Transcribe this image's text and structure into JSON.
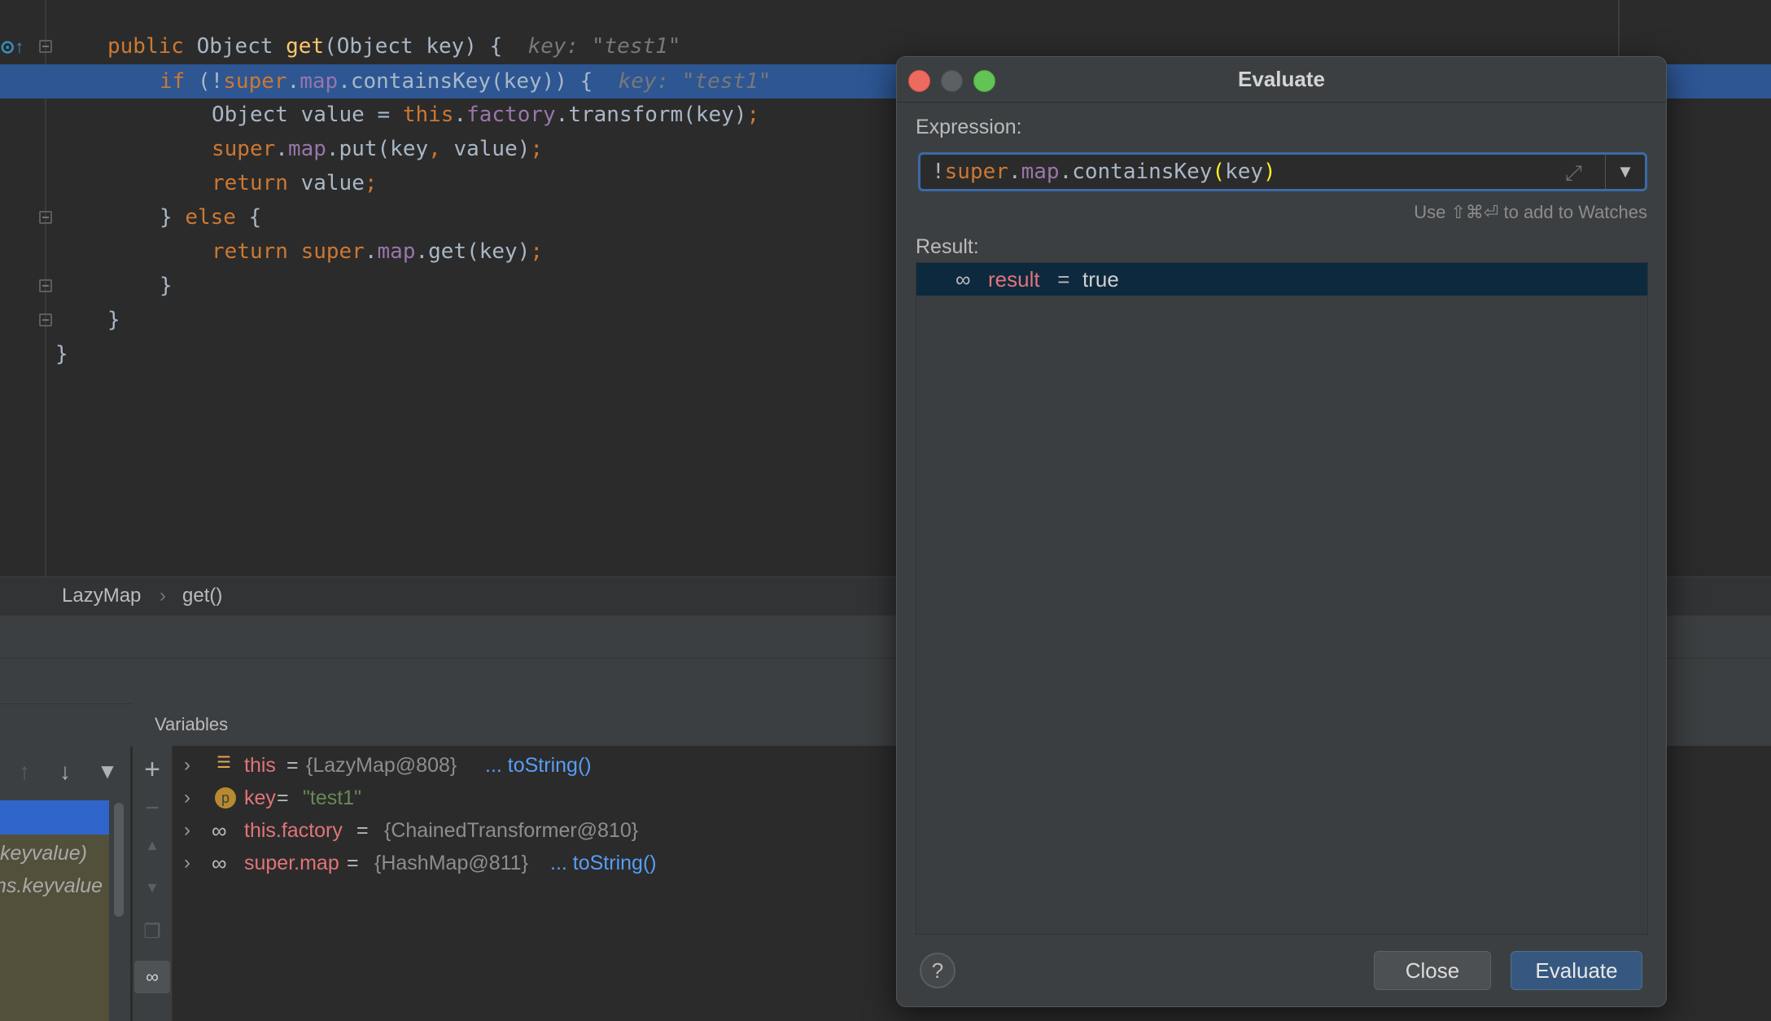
{
  "editor": {
    "lines": [
      {
        "tokens": [
          {
            "t": "public ",
            "c": "kw"
          },
          {
            "t": "Object ",
            "c": "plain"
          },
          {
            "t": "get",
            "c": "fn"
          },
          {
            "t": "(Object key) {",
            "c": "plain"
          },
          {
            "t": "  key: \"test1\"",
            "c": "hint"
          }
        ]
      },
      {
        "tokens": [
          {
            "t": "if ",
            "c": "kw"
          },
          {
            "t": "(!",
            "c": "plain"
          },
          {
            "t": "super",
            "c": "kw"
          },
          {
            "t": ".",
            "c": "plain"
          },
          {
            "t": "map",
            "c": "fld"
          },
          {
            "t": ".containsKey(key)) {",
            "c": "plain"
          },
          {
            "t": "  key: \"test1\"",
            "c": "hint"
          }
        ]
      },
      {
        "tokens": [
          {
            "t": "Object value = ",
            "c": "plain"
          },
          {
            "t": "this",
            "c": "kw"
          },
          {
            "t": ".",
            "c": "plain"
          },
          {
            "t": "factory",
            "c": "fld"
          },
          {
            "t": ".transform(key)",
            "c": "plain"
          },
          {
            "t": ";",
            "c": "kw"
          }
        ]
      },
      {
        "tokens": [
          {
            "t": "super",
            "c": "kw"
          },
          {
            "t": ".",
            "c": "plain"
          },
          {
            "t": "map",
            "c": "fld"
          },
          {
            "t": ".put(key",
            "c": "plain"
          },
          {
            "t": ", ",
            "c": "kw"
          },
          {
            "t": "value)",
            "c": "plain"
          },
          {
            "t": ";",
            "c": "kw"
          }
        ]
      },
      {
        "tokens": [
          {
            "t": "return ",
            "c": "kw"
          },
          {
            "t": "value",
            "c": "plain"
          },
          {
            "t": ";",
            "c": "kw"
          }
        ]
      },
      {
        "tokens": [
          {
            "t": "} ",
            "c": "plain"
          },
          {
            "t": "else ",
            "c": "kw"
          },
          {
            "t": "{",
            "c": "plain"
          }
        ]
      },
      {
        "tokens": [
          {
            "t": "return ",
            "c": "kw"
          },
          {
            "t": "super",
            "c": "kw"
          },
          {
            "t": ".",
            "c": "plain"
          },
          {
            "t": "map",
            "c": "fld"
          },
          {
            "t": ".get(key)",
            "c": "plain"
          },
          {
            "t": ";",
            "c": "kw"
          }
        ]
      },
      {
        "tokens": [
          {
            "t": "}",
            "c": "plain"
          }
        ]
      },
      {
        "tokens": [
          {
            "t": "}",
            "c": "plain"
          }
        ]
      },
      {
        "tokens": [
          {
            "t": "}",
            "c": "plain"
          }
        ]
      }
    ]
  },
  "breadcrumb": {
    "class_name": "LazyMap",
    "separator": "›",
    "method": "get()"
  },
  "debugger": {
    "variables_title": "Variables",
    "frames": [
      "keyvalue)",
      "ns.keyvalue"
    ],
    "variables": [
      {
        "name": "this",
        "eq": " = ",
        "value": "{LazyMap@808}",
        "link": "... toString()",
        "icon": "field-list-icon"
      },
      {
        "name": "key",
        "eq": " = ",
        "value": "\"test1\"",
        "link": "",
        "icon": "parameter-icon",
        "is_string": true
      },
      {
        "name": "this.factory",
        "eq": " = ",
        "value": "{ChainedTransformer@810}",
        "link": "",
        "icon": "watch-glasses-icon"
      },
      {
        "name": "super.map",
        "eq": " = ",
        "value": "{HashMap@811}",
        "link": "... toString()",
        "icon": "watch-glasses-icon"
      }
    ]
  },
  "dialog": {
    "title": "Evaluate",
    "expression_label": "Expression:",
    "expression_tokens": [
      {
        "t": "!",
        "c": "plain"
      },
      {
        "t": "super",
        "c": "kw"
      },
      {
        "t": ".",
        "c": "plain"
      },
      {
        "t": "map",
        "c": "fld"
      },
      {
        "t": ".containsKey",
        "c": "plain"
      },
      {
        "t": "(",
        "c": "paren"
      },
      {
        "t": "key",
        "c": "plain"
      },
      {
        "t": ")",
        "c": "paren"
      }
    ],
    "watch_hint": "Use ⇧⌘⏎ to add to Watches",
    "result_label": "Result:",
    "result": {
      "name": "result",
      "eq": " = ",
      "value": "true"
    },
    "help_label": "?",
    "close_label": "Close",
    "evaluate_label": "Evaluate"
  },
  "colors": {
    "keyword": "#cc7832",
    "field": "#9876aa",
    "method": "#ffc66d",
    "selection": "#2d5693",
    "accent_button": "#365880"
  }
}
